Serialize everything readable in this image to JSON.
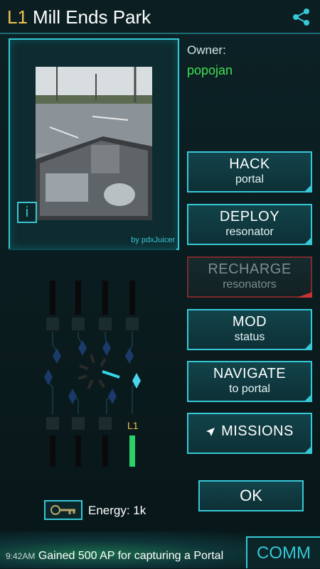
{
  "header": {
    "level": "L1",
    "title": "Mill Ends Park"
  },
  "portal_image": {
    "credit": "by pdxJuicer",
    "info_glyph": "i"
  },
  "owner": {
    "label": "Owner:",
    "name": "popojan",
    "name_color": "#3fe052"
  },
  "actions": {
    "hack": {
      "line1": "HACK",
      "line2": "portal"
    },
    "deploy": {
      "line1": "DEPLOY",
      "line2": "resonator"
    },
    "recharge": {
      "line1": "RECHARGE",
      "line2": "resonators",
      "disabled": true
    },
    "mod": {
      "line1": "MOD",
      "line2": "status"
    },
    "navigate": {
      "line1": "NAVIGATE",
      "line2": "to portal"
    },
    "missions": {
      "label": "MISSIONS",
      "icon": "navigation-arrow-icon"
    }
  },
  "resonators": {
    "deployed_level": "L1"
  },
  "energy": {
    "label": "Energy: 1k",
    "icon": "key-icon"
  },
  "ok_label": "OK",
  "ticker": {
    "time": "9:42AM",
    "message": "Gained 500 AP for capturing a Portal"
  },
  "comm_label": "COMM",
  "colors": {
    "accent": "#36c8d6",
    "level": "#f2c04f",
    "disabled_border": "#7c2a2a"
  }
}
